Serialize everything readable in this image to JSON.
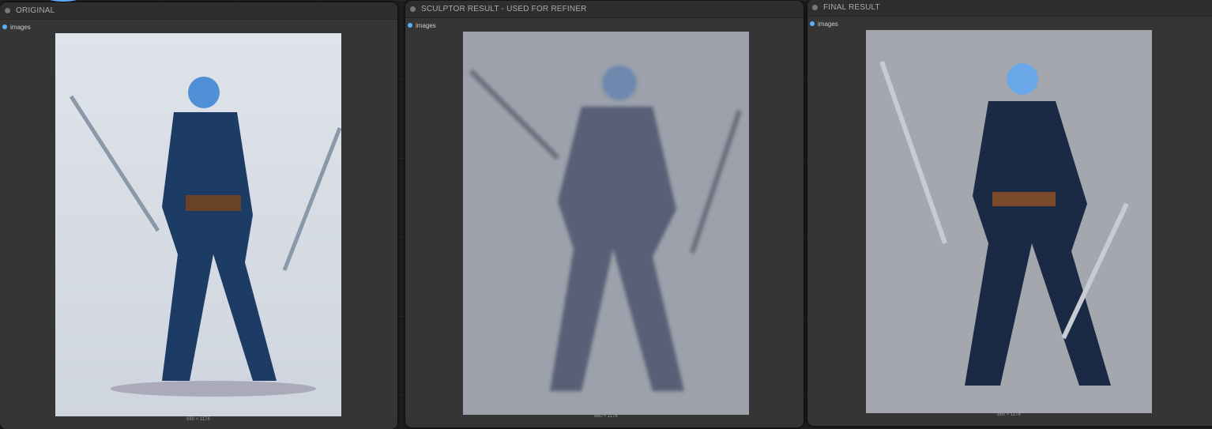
{
  "nodes": [
    {
      "title": "ORIGINAL",
      "output": "images",
      "size": "880 × 1176"
    },
    {
      "title": "SCULPTOR RESULT - USED FOR REFINER",
      "output": "images",
      "size": "880 × 1176"
    },
    {
      "title": "FINAL RESULT",
      "output": "images",
      "size": "880 × 1176"
    }
  ],
  "colors": {
    "accent": "#5ab0ff",
    "node_bg": "#353535"
  }
}
